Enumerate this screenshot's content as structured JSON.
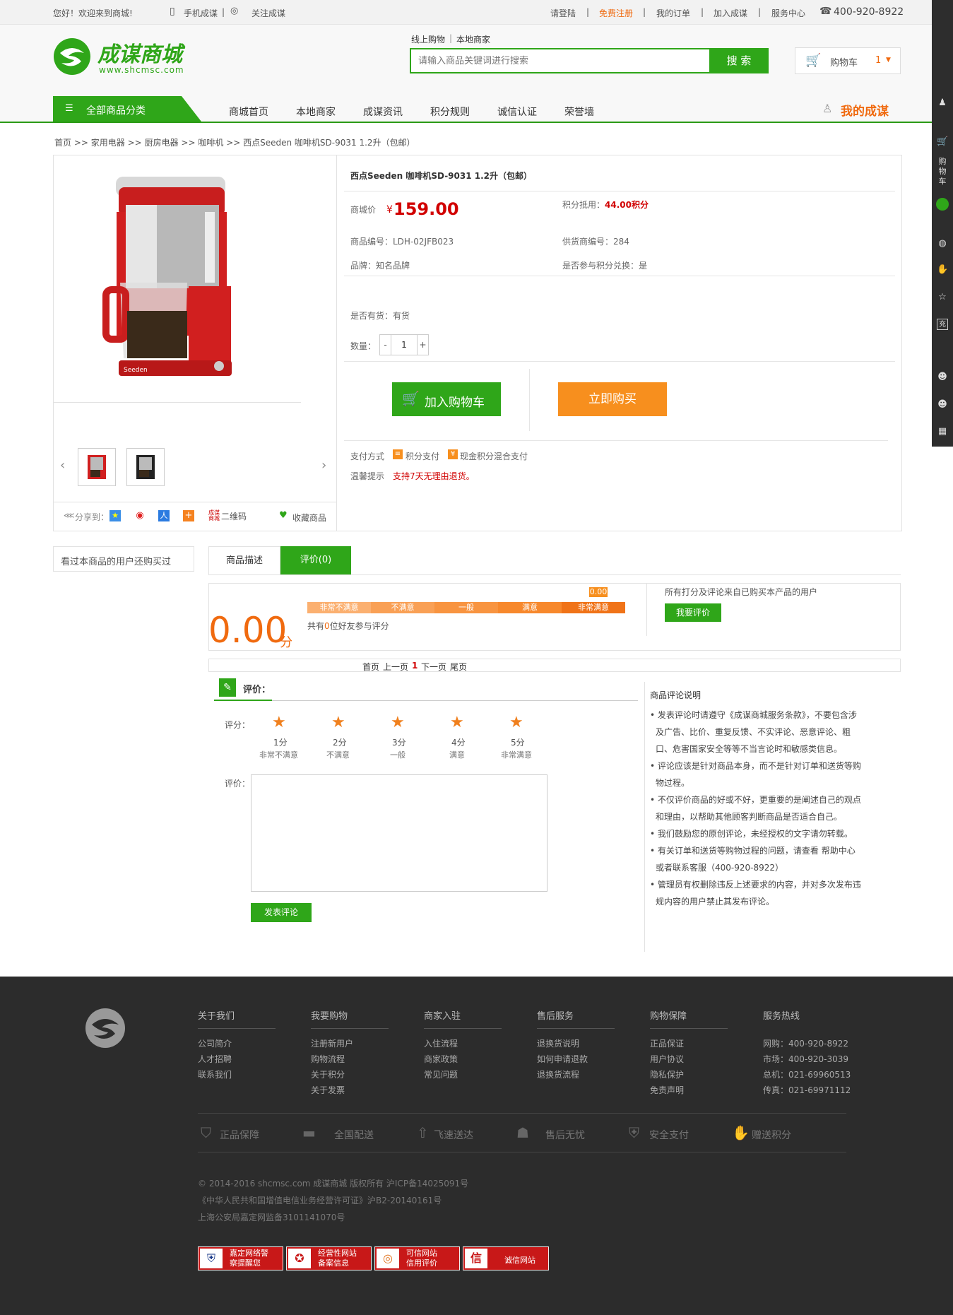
{
  "topbar": {
    "welcome": "您好！欢迎来到商城!",
    "mobile": "手机成谋",
    "follow": "关注成谋",
    "login": "请登陆",
    "register": "免费注册",
    "orders": "我的订单",
    "join_cart": "加入成谋",
    "service": "服务中心",
    "phone": "400-920-8922",
    "sep": "|"
  },
  "header": {
    "logo_cn": "成谋商城",
    "logo_url": "www.shcmsc.com",
    "search_tabs": [
      "线上购物",
      "本地商家"
    ],
    "search_placeholder": "请输入商品关键词进行搜索",
    "search_btn": "搜 索",
    "cart_label": "购物车",
    "cart_count": "1",
    "cart_arrow": "▼"
  },
  "nav": {
    "all_categories": "全部商品分类",
    "items": [
      "商城首页",
      "本地商家",
      "成谋资讯",
      "积分规则",
      "诚信认证",
      "荣誉墙"
    ],
    "my": "我的成谋"
  },
  "breadcrumb": [
    "首页",
    ">>",
    "家用电器",
    ">>",
    "厨房电器",
    ">>",
    "咖啡机",
    ">>",
    "西点Seeden 咖啡机SD-9031 1.2升（包邮）"
  ],
  "product": {
    "title": "西点Seeden 咖啡机SD-9031 1.2升（包邮）",
    "price_label": "商城价",
    "currency": "¥",
    "price": "159.00",
    "points_label": "积分抵用：",
    "points": "44.00积分",
    "sku_label": "商品编号：LDH-02JFB023",
    "supplier_label": "供货商编号：284",
    "brand_label": "品牌：知名品牌",
    "points_exchange": "是否参与积分兑换：是",
    "stock": "是否有货：有货",
    "qty_label": "数量：",
    "qty_minus": "-",
    "qty": "1",
    "qty_plus": "+",
    "add_cart": "加入购物车",
    "buy_now": "立即购买",
    "pay_label": "支付方式",
    "pay1": "积分支付",
    "pay2": "现金积分混合支付",
    "tip_label": "温馨提示",
    "tip": "支持7天无理由退货。"
  },
  "gallery": {
    "prev": "‹",
    "next": "›",
    "share_label": "分享到：",
    "qrcode": "二维码",
    "fav": "收藏商品"
  },
  "sidebox": {
    "title": "看过本商品的用户还购买过"
  },
  "tabs": [
    "商品描述",
    "评价(0)"
  ],
  "rating": {
    "score": "0.00",
    "unit": "分",
    "marker": "0.00",
    "segments": [
      "非常不满意",
      "不满意",
      "一般",
      "满意",
      "非常满意"
    ],
    "count_pre": "共有",
    "count": "0",
    "count_post": "位好友参与评分",
    "note": "所有打分及评论来自已购买本产品的用户",
    "btn": "我要评价"
  },
  "pager": [
    "首页",
    "上一页",
    "1",
    "下一页",
    "尾页"
  ],
  "review_form": {
    "title": "评价：",
    "score_label": "评分：",
    "stars": [
      {
        "n": "1分",
        "d": "非常不满意"
      },
      {
        "n": "2分",
        "d": "不满意"
      },
      {
        "n": "3分",
        "d": "一般"
      },
      {
        "n": "4分",
        "d": "满意"
      },
      {
        "n": "5分",
        "d": "非常满意"
      }
    ],
    "comment_label": "评价：",
    "submit": "发表评论"
  },
  "review_rules": {
    "title": "商品评论说明",
    "lines": [
      "• 发表评论时请遵守《成谋商城服务条款》，不要包含涉",
      "及广告、比价、重复反馈、不实评论、恶意评论、粗",
      "口、危害国家安全等等不当言论时和敏感类信息。",
      "• 评论应该是针对商品本身，而不是针对订单和送货等购",
      "物过程。",
      "• 不仅评价商品的好或不好，更重要的是阐述自己的观点",
      "和理由，以帮助其他顾客判断商品是否适合自己。",
      "• 我们鼓励您的原创评论，未经授权的文字请勿转载。",
      "• 有关订单和送货等购物过程的问题，请查看 帮助中心",
      "或者联系客服（400-920-8922）",
      "• 管理员有权删除违反上述要求的内容，并对多次发布违",
      "规内容的用户禁止其发布评论。"
    ]
  },
  "footer": {
    "cols": [
      {
        "title": "关于我们",
        "links": [
          "公司简介",
          "人才招聘",
          "联系我们"
        ]
      },
      {
        "title": "我要购物",
        "links": [
          "注册新用户",
          "购物流程",
          "关于积分",
          "关于发票"
        ]
      },
      {
        "title": "商家入驻",
        "links": [
          "入住流程",
          "商家政策",
          "常见问题"
        ]
      },
      {
        "title": "售后服务",
        "links": [
          "退换货说明",
          "如何申请退款",
          "退换货流程"
        ]
      },
      {
        "title": "购物保障",
        "links": [
          "正品保证",
          "用户协议",
          "隐私保护",
          "免责声明"
        ]
      },
      {
        "title": "服务热线",
        "links": [
          "网购：400-920-8922",
          "市场：400-920-3039",
          "总机：021-69960513",
          "传真：021-69971112"
        ]
      }
    ],
    "guarantees": [
      "正品保障",
      "全国配送",
      "飞速送达",
      "售后无忧",
      "安全支付",
      "赠送积分"
    ],
    "copyright": [
      "© 2014-2016 shcmsc.com 成谋商城 版权所有 沪ICP备14025091号",
      "《中华人民共和国增值电信业务经营许可证》沪B2-20140161号",
      "上海公安局嘉定网监备3101141070号"
    ],
    "badges": [
      {
        "l1": "嘉定网络警",
        "l2": "察提醒您"
      },
      {
        "l1": "经营性网站",
        "l2": "备案信息"
      },
      {
        "l1": "可信网站",
        "l2": "信用评价"
      },
      {
        "l1": "诚信网站",
        "l2": ""
      }
    ]
  },
  "colors": {
    "green": "#2fa619",
    "orange": "#f78f1e",
    "red": "#d10000"
  },
  "rightbar": {
    "cart_label": "购物车"
  }
}
